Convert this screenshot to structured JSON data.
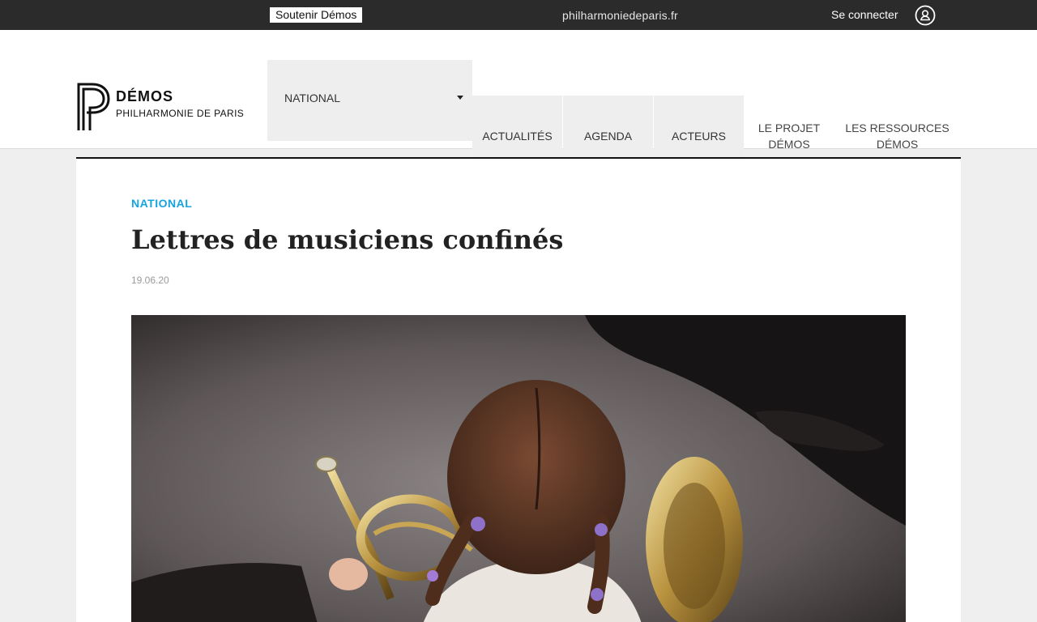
{
  "topbar": {
    "support_label": "Soutenir Démos",
    "site_link": "philharmoniedeparis.fr",
    "login_label": "Se connecter",
    "user_icon": "user-icon"
  },
  "header": {
    "logo_title": "DÉMOS",
    "logo_subtitle": "PHILHARMONIE DE PARIS",
    "nav_selected": "NATIONAL",
    "nav": [
      {
        "label": "ACTUALITÉS"
      },
      {
        "label": "AGENDA"
      },
      {
        "label": "ACTEURS"
      }
    ],
    "nav_links": [
      {
        "line1": "LE PROJET",
        "line2": "DÉMOS"
      },
      {
        "line1": "LES RESSOURCES",
        "line2": "DÉMOS"
      }
    ]
  },
  "article": {
    "category": "NATIONAL",
    "title": "Lettres de musiciens confinés",
    "date": "19.06.20"
  },
  "colors": {
    "topbar": "#2b2b2b",
    "accent": "#16a4e0",
    "nav_bg": "#eeeeee"
  }
}
